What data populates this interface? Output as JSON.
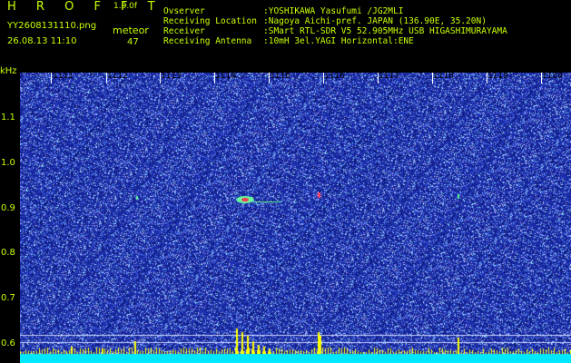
{
  "header": {
    "app_title": "H R O F F T",
    "version": "1.0.0f",
    "filename": "YY2608131110.png",
    "timestamp": "26.08.13 11:10",
    "meteor_label": "meteor",
    "meteor_count": "47"
  },
  "info": {
    "observer_label": "Ovserver",
    "observer_value": ":YOSHIKAWA Yasufumi /JG2MLI",
    "location_label": "Receiving Location",
    "location_value": ":Nagoya Aichi-pref. JAPAN (136.90E, 35.20N)",
    "receiver_label": "Receiver",
    "receiver_value": ":SMart RTL-SDR V5 52.905MHz USB HIGASHIMURAYAMA",
    "antenna_label": "Receiving Antenna",
    "antenna_value": ":10mH 3el.YAGI Horizontal:ENE"
  },
  "plot": {
    "y_unit": "kHz",
    "y_ticks": [
      "1.1",
      "1.0",
      "0.9",
      "0.8",
      "0.7",
      "0.6"
    ],
    "x_ticks": [
      "1111",
      "1112",
      "1113",
      "1114",
      "1116",
      "1116",
      "1117",
      "1118",
      "1119",
      "1120"
    ],
    "colors": {
      "background": "#1a2aa8",
      "noise_light": "#8fb6ff",
      "noise_dark": "#0a1670",
      "text": "#c8ff00",
      "baseline": "#00e8ff",
      "bars": "#ffff00"
    }
  }
}
